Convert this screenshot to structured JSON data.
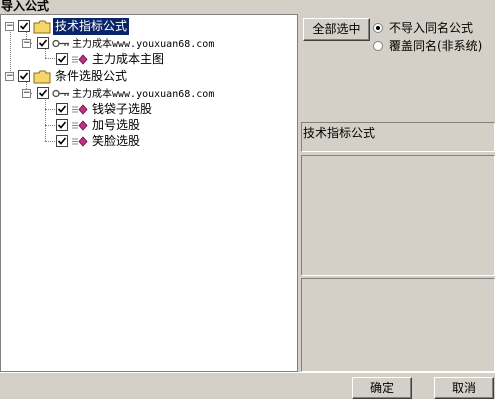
{
  "window": {
    "title": "导入公式"
  },
  "tree": {
    "root1": {
      "label": "技术指标公式",
      "children": [
        {
          "label": "主力成本www.youxuan68.com",
          "children": [
            {
              "label": "主力成本主图"
            }
          ]
        }
      ]
    },
    "root2": {
      "label": "条件选股公式",
      "children": [
        {
          "label": "主力成本www.youxuan68.com",
          "children": [
            {
              "label": "钱袋子选股"
            },
            {
              "label": "加号选股"
            },
            {
              "label": "笑脸选股"
            }
          ]
        }
      ]
    }
  },
  "options": {
    "select_all_label": "全部选中",
    "radio_options": [
      {
        "label": "不导入同名公式",
        "checked": true
      },
      {
        "label": "覆盖同名(非系统)",
        "checked": false
      }
    ]
  },
  "info": {
    "header": "技术指标公式"
  },
  "footer": {
    "ok_label": "确定",
    "cancel_label": "取消"
  },
  "colors": {
    "selection": "#0a246a",
    "face": "#d4d0c8",
    "key_icon": "#404040",
    "diamond_icon": "#c03080"
  }
}
